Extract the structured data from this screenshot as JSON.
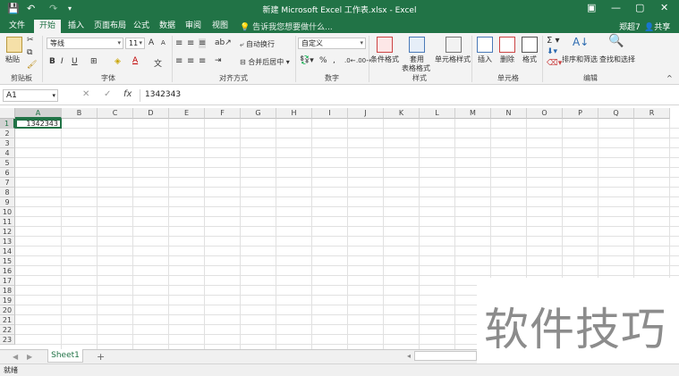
{
  "titlebar": {
    "title": "新建 Microsoft Excel 工作表.xlsx - Excel",
    "save_icon": "💾",
    "undo_icon": "↶",
    "redo_icon": "↷",
    "customize_icon": "▾",
    "minimize": "—",
    "restore": "▢",
    "close": "✕",
    "ribbon_display": "▣"
  },
  "tabs": {
    "file": "文件",
    "home": "开始",
    "insert": "插入",
    "layout": "页面布局",
    "formulas": "公式",
    "data": "数据",
    "review": "审阅",
    "view": "视图",
    "tell_me": "告诉我您想要做什么...",
    "user": "郑超7",
    "share": "共享"
  },
  "ribbon": {
    "clipboard": {
      "paste": "粘贴",
      "label": "剪贴板"
    },
    "font": {
      "name": "等线",
      "size": "11",
      "bold": "B",
      "italic": "I",
      "underline": "U",
      "label": "字体",
      "grow": "A",
      "shrink": "A"
    },
    "alignment": {
      "wrap": "自动换行",
      "merge": "合并后居中",
      "label": "对齐方式"
    },
    "number": {
      "format": "自定义",
      "percent": "%",
      "comma": ",",
      "label": "数字"
    },
    "styles": {
      "conditional": "条件格式",
      "table_l1": "套用",
      "table_l2": "表格格式",
      "cell_styles": "单元格样式",
      "label": "样式"
    },
    "cells": {
      "insert": "插入",
      "delete": "删除",
      "format": "格式",
      "label": "单元格"
    },
    "editing": {
      "sort": "排序和筛选",
      "find": "查找和选择",
      "label": "编辑"
    }
  },
  "formula_bar": {
    "name_box": "A1",
    "cancel": "✕",
    "enter": "✓",
    "fx": "fx",
    "value": "1342343"
  },
  "grid": {
    "columns": [
      "A",
      "B",
      "C",
      "D",
      "E",
      "F",
      "G",
      "H",
      "I",
      "J",
      "K",
      "L",
      "M",
      "N",
      "O",
      "P",
      "Q",
      "R"
    ],
    "rows": [
      "1",
      "2",
      "3",
      "4",
      "5",
      "6",
      "7",
      "8",
      "9",
      "10",
      "11",
      "12",
      "13",
      "14",
      "15",
      "16",
      "17",
      "18",
      "19",
      "20",
      "21",
      "22",
      "23"
    ],
    "a1_value": "1342343"
  },
  "sheets": {
    "tabs": [
      "Sheet1"
    ],
    "add": "+"
  },
  "status": {
    "text": "就绪"
  },
  "watermark": {
    "text": "软件技巧"
  },
  "colors": {
    "accent": "#217346"
  }
}
